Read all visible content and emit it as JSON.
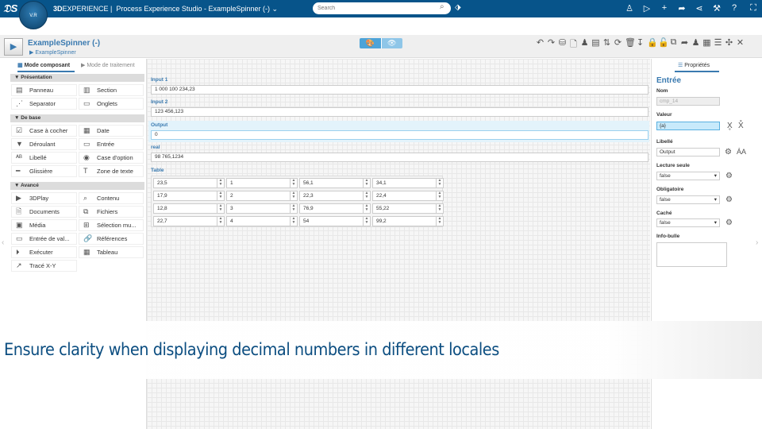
{
  "topbar": {
    "brand_bold": "3D",
    "brand": "EXPERIENCE |",
    "app_title": "Process Experience Studio - ExampleSpinner (-)",
    "compass_label": "V.R",
    "search_placeholder": "Search",
    "icons": [
      "user-icon",
      "tag-icon",
      "plus-icon",
      "share-icon",
      "network-icon",
      "tools-icon",
      "help-icon",
      "fullscreen-icon"
    ]
  },
  "header": {
    "title": "ExampleSpinner (-)",
    "subtitle": "ExampleSpinner"
  },
  "left_panel": {
    "tabs": [
      {
        "label": "Mode composant",
        "active": true
      },
      {
        "label": "Mode de traitement",
        "active": false
      }
    ],
    "sections": [
      {
        "title": "Présentation",
        "items": [
          {
            "label": "Panneau",
            "icon": "panel-icon"
          },
          {
            "label": "Section",
            "icon": "section-icon"
          },
          {
            "label": "Separator",
            "icon": "separator-icon"
          },
          {
            "label": "Onglets",
            "icon": "tabs-icon"
          }
        ]
      },
      {
        "title": "De base",
        "items": [
          {
            "label": "Case à cocher",
            "icon": "checkbox-icon"
          },
          {
            "label": "Date",
            "icon": "calendar-icon"
          },
          {
            "label": "Déroulant",
            "icon": "dropdown-icon"
          },
          {
            "label": "Entrée",
            "icon": "input-icon"
          },
          {
            "label": "Libellé",
            "icon": "label-icon"
          },
          {
            "label": "Case d'option",
            "icon": "radio-icon"
          },
          {
            "label": "Glissière",
            "icon": "slider-icon"
          },
          {
            "label": "Zone de texte",
            "icon": "text-icon"
          }
        ]
      },
      {
        "title": "Avancé",
        "items": [
          {
            "label": "3DPlay",
            "icon": "play-icon"
          },
          {
            "label": "Contenu",
            "icon": "search-icon"
          },
          {
            "label": "Documents",
            "icon": "document-icon"
          },
          {
            "label": "Fichiers",
            "icon": "files-icon"
          },
          {
            "label": "Média",
            "icon": "media-icon"
          },
          {
            "label": "Sélection mu...",
            "icon": "multiselect-icon"
          },
          {
            "label": "Entrée de val...",
            "icon": "value-input-icon"
          },
          {
            "label": "Références",
            "icon": "link-icon"
          },
          {
            "label": "Exécuter",
            "icon": "run-icon"
          },
          {
            "label": "Tableau",
            "icon": "table-icon"
          },
          {
            "label": "Tracé X-Y",
            "icon": "chart-icon"
          }
        ]
      }
    ]
  },
  "form": {
    "fields": [
      {
        "label": "Input 1",
        "value": "1 000 100 234,23"
      },
      {
        "label": "Input 2",
        "value": "123 456,123"
      },
      {
        "label": "Output",
        "value": "0"
      },
      {
        "label": "real",
        "value": "98 765,1234"
      }
    ],
    "table_label": "Table",
    "table": [
      [
        "23,5",
        "1",
        "56,1",
        "34,1"
      ],
      [
        "17,9",
        "2",
        "22,3",
        "22,4"
      ],
      [
        "12,8",
        "3",
        "76,9",
        "55,22"
      ],
      [
        "22,7",
        "4",
        "54",
        "99,2"
      ]
    ]
  },
  "properties": {
    "tab": "Propriétés",
    "title": "Entrée",
    "nom_label": "Nom",
    "nom_value": "cmp_14",
    "valeur_label": "Valeur",
    "valeur_value": "{a}",
    "libelle_label": "Libellé",
    "libelle_value": "Output",
    "lecture_label": "Lecture seule",
    "lecture_value": "false",
    "obligatoire_label": "Obligatoire",
    "obligatoire_value": "false",
    "cache_label": "Caché",
    "cache_value": "false",
    "infobulle_label": "Info-bulle",
    "infobulle_value": ""
  },
  "banner": {
    "text": "Ensure clarity when displaying decimal numbers in different locales"
  },
  "colors": {
    "topbar": "#07548a",
    "accent": "#3a7ab0",
    "banner_text": "#0b4d80"
  }
}
